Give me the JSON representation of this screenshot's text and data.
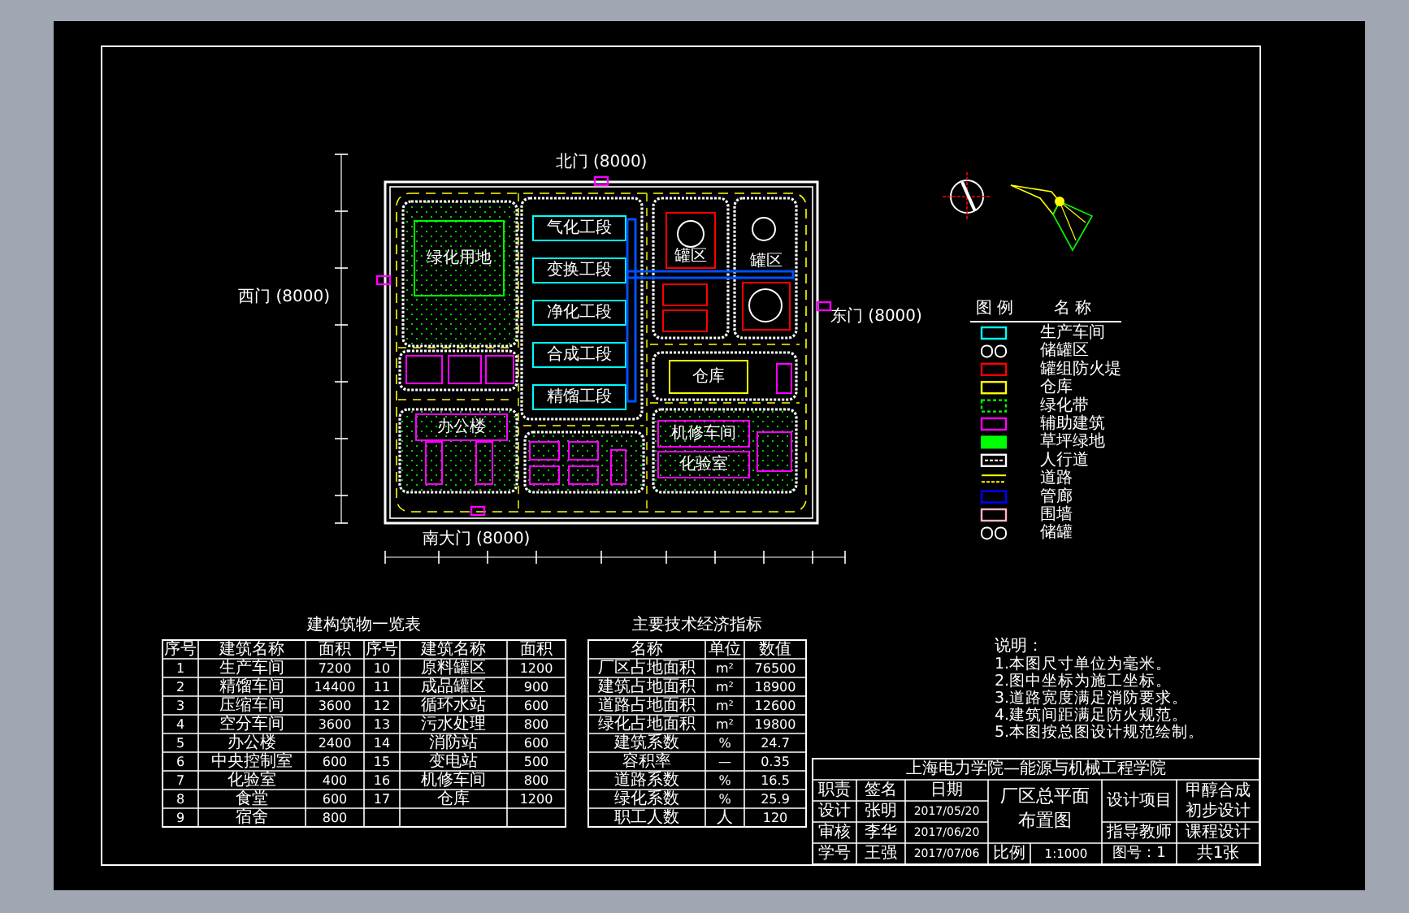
{
  "site_plan": {
    "gates": [
      {
        "label": "北门 (8000)"
      },
      {
        "label": "东门 (8000)"
      },
      {
        "label": "西门 (8000)"
      },
      {
        "label": "南大门 (8000)"
      }
    ],
    "buildings": [
      {
        "label": "绿化用地",
        "color": "#00ff00"
      },
      {
        "label": "气化工段",
        "color": "#00ffff"
      },
      {
        "label": "变换工段",
        "color": "#00ffff"
      },
      {
        "label": "净化工段",
        "color": "#00ffff"
      },
      {
        "label": "合成工段",
        "color": "#00ffff"
      },
      {
        "label": "精馏工段",
        "color": "#00ffff"
      },
      {
        "label": "罐区",
        "color": "#ff0000"
      },
      {
        "label": "罐区",
        "color": "#ff0000"
      },
      {
        "label": "仓库",
        "color": "#ffff00"
      },
      {
        "label": "办公楼",
        "color": "#ff00ff"
      },
      {
        "label": "机修车间",
        "color": "#ff00ff"
      },
      {
        "label": "化验室",
        "color": "#ff00ff"
      }
    ]
  },
  "legend": {
    "headers": [
      "图 例",
      "名 称"
    ],
    "items": [
      {
        "label": "生产车间",
        "kind": "outline",
        "color": "#00ffff"
      },
      {
        "label": "储罐区",
        "kind": "tanks",
        "color": "#ffffff"
      },
      {
        "label": "罐组防火堤",
        "kind": "outline",
        "color": "#ff0000"
      },
      {
        "label": "仓库",
        "kind": "outline",
        "color": "#ffff00"
      },
      {
        "label": "绿化带",
        "kind": "dashed",
        "color": "#00ff00"
      },
      {
        "label": "辅助建筑",
        "kind": "outline",
        "color": "#ff00ff"
      },
      {
        "label": "草坪绿地",
        "kind": "filled",
        "color": "#00ff00"
      },
      {
        "label": "人行道",
        "kind": "road",
        "color": "#ffffff"
      },
      {
        "label": "道路",
        "kind": "lines",
        "color": "#ffff00"
      },
      {
        "label": "管廊",
        "kind": "outline",
        "color": "#0000ff"
      },
      {
        "label": "围墙",
        "kind": "outline",
        "color": "#ffb6c1"
      },
      {
        "label": "储罐",
        "kind": "tanks",
        "color": "#ffffff"
      }
    ]
  },
  "buildings_table": {
    "title": "建构筑物一览表",
    "columns": [
      "序号",
      "建筑名称",
      "面积",
      "序号",
      "建筑名称",
      "面积"
    ],
    "rows": [
      [
        "1",
        "生产车间",
        "7200",
        "10",
        "原料罐区",
        "1200"
      ],
      [
        "2",
        "精馏车间",
        "14400",
        "11",
        "成品罐区",
        "900"
      ],
      [
        "3",
        "压缩车间",
        "3600",
        "12",
        "循环水站",
        "600"
      ],
      [
        "4",
        "空分车间",
        "3600",
        "13",
        "污水处理",
        "800"
      ],
      [
        "5",
        "办公楼",
        "2400",
        "14",
        "消防站",
        "600"
      ],
      [
        "6",
        "中央控制室",
        "600",
        "15",
        "变电站",
        "500"
      ],
      [
        "7",
        "化验室",
        "400",
        "16",
        "机修车间",
        "800"
      ],
      [
        "8",
        "食堂",
        "600",
        "17",
        "仓库",
        "1200"
      ],
      [
        "9",
        "宿舍",
        "800"
      ]
    ]
  },
  "indicators_table": {
    "title": "主要技术经济指标",
    "columns": [
      "名称",
      "单位",
      "数值"
    ],
    "rows": [
      [
        "厂区占地面积",
        "m²",
        "76500"
      ],
      [
        "建筑占地面积",
        "m²",
        "18900"
      ],
      [
        "道路占地面积",
        "m²",
        "12600"
      ],
      [
        "绿化占地面积",
        "m²",
        "19800"
      ],
      [
        "建筑系数",
        "%",
        "24.7"
      ],
      [
        "容积率",
        "—",
        "0.35"
      ],
      [
        "道路系数",
        "%",
        "16.5"
      ],
      [
        "绿化系数",
        "%",
        "25.9"
      ],
      [
        "职工人数",
        "人",
        "120"
      ]
    ]
  },
  "notes": {
    "heading": "说明：",
    "lines": [
      "1.本图尺寸单位为毫米。",
      "2.图中坐标为施工坐标。",
      "3.道路宽度满足消防要求。",
      "4.建筑间距满足防火规范。",
      "5.本图按总图设计规范绘制。"
    ]
  },
  "title_block": {
    "school": "上海电力学院—能源与机械工程学院",
    "rows": [
      [
        "职责",
        "签名",
        "日期"
      ],
      [
        "设计",
        "张明",
        "2017/05/20"
      ],
      [
        "审核",
        "李华",
        "2017/06/20"
      ],
      [
        "学号",
        "王强",
        "2017/07/06"
      ]
    ],
    "drawing_title": [
      "厂区总平面",
      "布置图"
    ],
    "scale_label": "比例",
    "scale": "1:1000",
    "project_label": "设计项目",
    "project": [
      "甲醇合成",
      "初步设计"
    ],
    "teacher_label": "指导教师",
    "course": "课程设计",
    "sheet": "图号：1",
    "total": "共1张"
  }
}
